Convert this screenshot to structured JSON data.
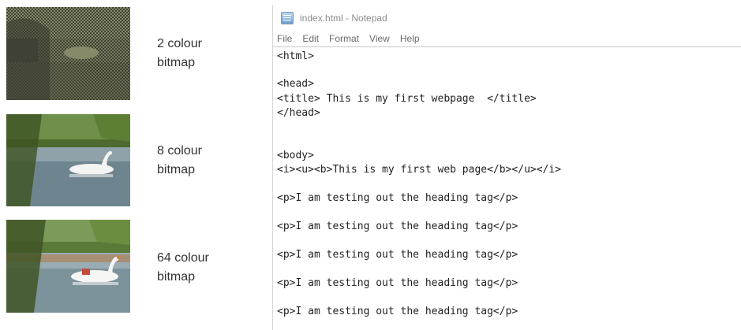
{
  "samples": [
    {
      "label_line1": "2 colour",
      "label_line2": "bitmap"
    },
    {
      "label_line1": "8 colour",
      "label_line2": "bitmap"
    },
    {
      "label_line1": "64 colour",
      "label_line2": "bitmap"
    }
  ],
  "notepad": {
    "title": "index.html - Notepad",
    "menu": [
      "File",
      "Edit",
      "Format",
      "View",
      "Help"
    ],
    "lines": [
      "<html>",
      "<head>",
      "<title> This is my first webpage  </title>",
      "</head>",
      "<body>",
      "<i><u><b>This is my first web page</b></u></i>",
      "<p>I am testing out the heading tag</p>",
      "<p>I am testing out the heading tag</p>",
      "<p>I am testing out the heading tag</p>",
      "<p>I am testing out the heading tag</p>",
      "<p>I am testing out the heading tag</p>"
    ]
  },
  "colors": {
    "two_colour_dark": "#3e4233",
    "two_colour_light": "#868a69",
    "water": "#8fa2aa",
    "foliage": "#5e7a3a",
    "swan": "#f4f4f2"
  }
}
